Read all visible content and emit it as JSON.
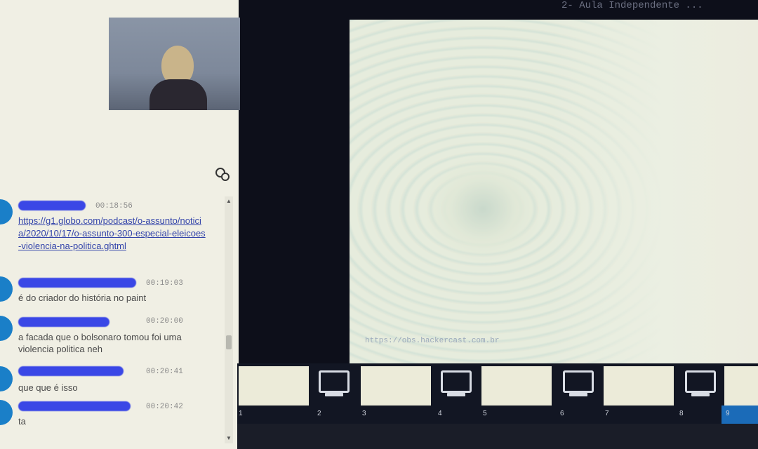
{
  "header": {
    "title": "2- Aula Independente ..."
  },
  "chat": {
    "messages": [
      {
        "user": "██████████",
        "time": "00:18:56",
        "link": "https://g1.globo.com/podcast/o-assunto/noticia/2020/10/17/o-assunto-300-especial-eleicoes-violencia-na-politica.ghtml"
      },
      {
        "user": "██████████████",
        "time": "00:19:03",
        "text": "é do criador do história no paint"
      },
      {
        "user": "██████████ ...",
        "time": "00:20:00",
        "text": "a facada que o bolsonaro tomou foi uma violencia politica neh"
      },
      {
        "user": "███████████████",
        "time": "00:20:41",
        "text": "que que é isso"
      },
      {
        "user": "████████████████",
        "time": "00:20:42",
        "text": "ta"
      }
    ]
  },
  "slide": {
    "caption": "https://obs.hackercast.com.br"
  },
  "thumbnails": [
    {
      "num": "1",
      "kind": "slide"
    },
    {
      "num": "2",
      "kind": "screen"
    },
    {
      "num": "3",
      "kind": "slide"
    },
    {
      "num": "4",
      "kind": "screen"
    },
    {
      "num": "5",
      "kind": "slide"
    },
    {
      "num": "6",
      "kind": "screen"
    },
    {
      "num": "7",
      "kind": "slide"
    },
    {
      "num": "8",
      "kind": "screen"
    },
    {
      "num": "9",
      "kind": "slide"
    }
  ],
  "icons": {
    "chat": "chat-bubbles-icon",
    "monitor": "monitor-icon"
  },
  "colors": {
    "avatar": "#1a7fc8",
    "link": "#3344aa",
    "active_thumb": "#1b6bb8"
  }
}
